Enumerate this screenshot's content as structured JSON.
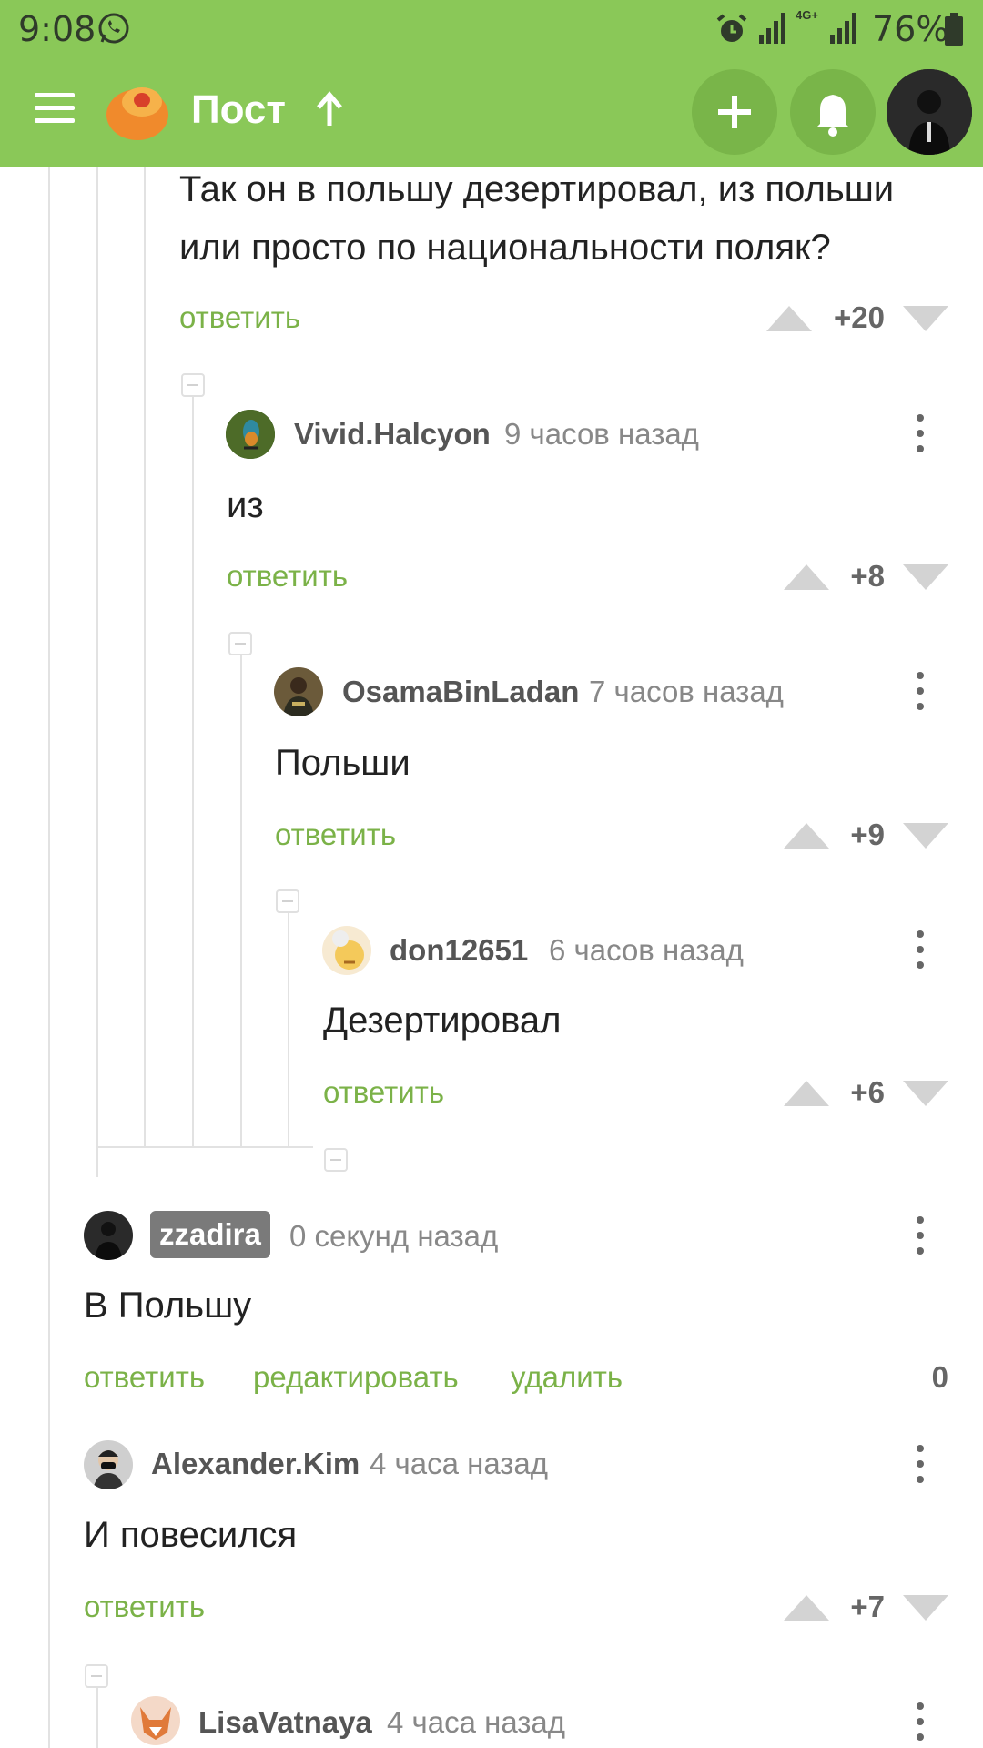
{
  "status_bar": {
    "time": "9:08",
    "network": "4G+",
    "battery": "76%"
  },
  "header": {
    "title": "Пост"
  },
  "comments": [
    {
      "text": "Так он в польшу дезертировал, из польши или просто по национальности поляк?",
      "reply": "ответить",
      "score": "+20"
    },
    {
      "author": "Vivid.Halcyon",
      "time": "9 часов назад",
      "text": "из",
      "reply": "ответить",
      "score": "+8"
    },
    {
      "author": "OsamaBinLadan",
      "time": "7 часов назад",
      "text": "Польши",
      "reply": "ответить",
      "score": "+9"
    },
    {
      "author": "don12651",
      "time": "6 часов назад",
      "text": "Дезертировал",
      "reply": "ответить",
      "score": "+6"
    },
    {
      "author": "zzadira",
      "time": "0 секунд назад",
      "text": "В Польшу",
      "reply": "ответить",
      "edit": "редактировать",
      "delete": "удалить",
      "score": "0"
    },
    {
      "author": "Alexander.Kim",
      "time": "4 часа назад",
      "text": "И повесился",
      "reply": "ответить",
      "score": "+7"
    },
    {
      "author": "LisaVatnaya",
      "time": "4 часа назад"
    }
  ],
  "colors": {
    "brand_green": "#8ac858",
    "link_green": "#7bb248"
  }
}
